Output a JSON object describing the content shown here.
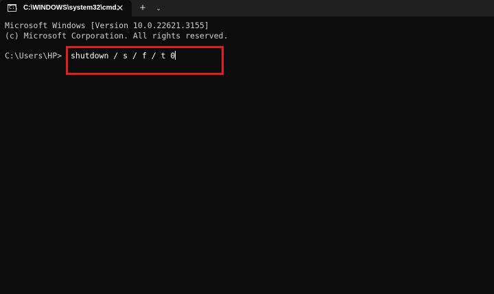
{
  "window": {
    "tab_title": "C:\\WINDOWS\\system32\\cmd.",
    "tab_icon_glyph": "C:\\",
    "close_glyph": "✕",
    "new_tab_glyph": "+",
    "dropdown_glyph": "⌄"
  },
  "terminal": {
    "lines": [
      "Microsoft Windows [Version 10.0.22621.3155]",
      "(c) Microsoft Corporation. All rights reserved."
    ],
    "prompt": "C:\\Users\\HP>",
    "command": "shutdown / s / f / t 0"
  },
  "colors": {
    "background": "#0c0c0c",
    "tab_bar": "#202020",
    "text": "#cccccc",
    "highlight": "#e0201b"
  },
  "icons": {
    "tab_icon": "terminal-icon",
    "close": "close-icon",
    "new_tab": "plus-icon",
    "dropdown": "chevron-down-icon"
  }
}
